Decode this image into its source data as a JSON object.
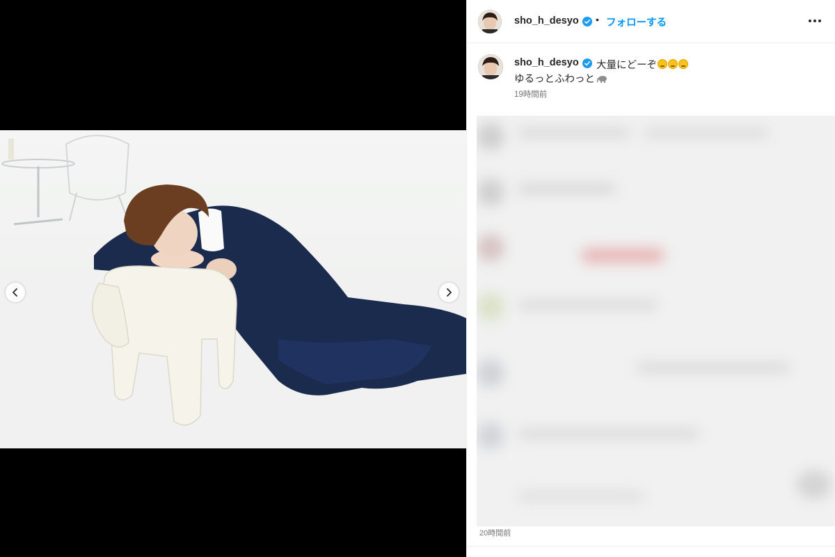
{
  "post": {
    "username": "sho_h_desyo",
    "separator": "•",
    "follow_label": "フォローする",
    "caption_line1": "大量にどーぞ",
    "caption_line2": "ゆるっとふわっと",
    "caption_time": "19時間前",
    "comments_time": "20時間前"
  },
  "icons": {
    "more": "more-horizontal-icon",
    "prev": "chevron-left-icon",
    "next": "chevron-right-icon",
    "verified": "verified-badge-icon"
  },
  "colors": {
    "accent": "#0095f6",
    "verified": "#1d9bf0",
    "text": "#262626",
    "muted": "#737373"
  }
}
